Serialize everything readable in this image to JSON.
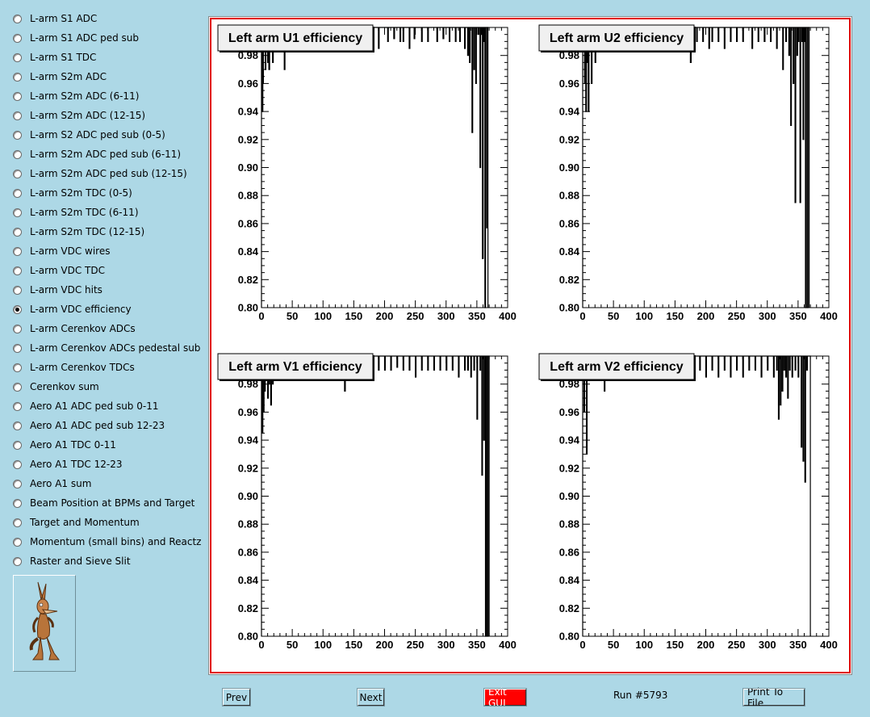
{
  "sidebar": {
    "items": [
      {
        "label": "L-arm S1 ADC",
        "selected": false
      },
      {
        "label": "L-arm S1 ADC ped sub",
        "selected": false
      },
      {
        "label": "L-arm S1 TDC",
        "selected": false
      },
      {
        "label": "L-arm S2m ADC",
        "selected": false
      },
      {
        "label": "L-arm S2m ADC (6-11)",
        "selected": false
      },
      {
        "label": "L-arm S2m ADC (12-15)",
        "selected": false
      },
      {
        "label": "L-arm S2 ADC ped sub (0-5)",
        "selected": false
      },
      {
        "label": "L-arm S2m ADC ped sub (6-11)",
        "selected": false
      },
      {
        "label": "L-arm S2m ADC ped sub (12-15)",
        "selected": false
      },
      {
        "label": "L-arm S2m TDC (0-5)",
        "selected": false
      },
      {
        "label": "L-arm S2m TDC (6-11)",
        "selected": false
      },
      {
        "label": "L-arm S2m TDC (12-15)",
        "selected": false
      },
      {
        "label": "L-arm VDC wires",
        "selected": false
      },
      {
        "label": "L-arm VDC TDC",
        "selected": false
      },
      {
        "label": "L-arm VDC hits",
        "selected": false
      },
      {
        "label": "L-arm VDC efficiency",
        "selected": true
      },
      {
        "label": "L-arm Cerenkov ADCs",
        "selected": false
      },
      {
        "label": "L-arm Cerenkov ADCs pedestal sub",
        "selected": false
      },
      {
        "label": "L-arm Cerenkov TDCs",
        "selected": false
      },
      {
        "label": "Cerenkov sum",
        "selected": false
      },
      {
        "label": "Aero A1 ADC ped sub 0-11",
        "selected": false
      },
      {
        "label": "Aero A1 ADC ped sub 12-23",
        "selected": false
      },
      {
        "label": "Aero A1 TDC 0-11",
        "selected": false
      },
      {
        "label": "Aero A1 TDC 12-23",
        "selected": false
      },
      {
        "label": "Aero A1 sum",
        "selected": false
      },
      {
        "label": "Beam Position at BPMs and Target",
        "selected": false
      },
      {
        "label": "Target and Momentum",
        "selected": false
      },
      {
        "label": "Momentum (small bins) and Reactz",
        "selected": false
      },
      {
        "label": "Raster and Sieve Slit",
        "selected": false
      }
    ]
  },
  "buttons": {
    "prev": "Prev",
    "next": "Next",
    "exit": "Exit GUI",
    "print": "Print To File"
  },
  "run_label": "Run #5793",
  "colors": {
    "background": "#add8e6",
    "canvas_border": "#e00000",
    "exit_button": "#ff0000",
    "plot_line": "#000000"
  },
  "chart_data": [
    {
      "type": "bar",
      "title": "Left arm U1 efficiency",
      "xlim": [
        0,
        400
      ],
      "ylim": [
        0.8,
        1.0
      ],
      "xticks": [
        "0",
        "50",
        "100",
        "150",
        "200",
        "250",
        "300",
        "350",
        "400"
      ],
      "yticks": [
        "0.80",
        "0.82",
        "0.84",
        "0.86",
        "0.88",
        "0.90",
        "0.92",
        "0.94",
        "0.96",
        "0.98"
      ],
      "fill_to": 368,
      "dips": [
        [
          1,
          0.94
        ],
        [
          2,
          0.96
        ],
        [
          4,
          0.985
        ],
        [
          6,
          0.97
        ],
        [
          8,
          0.99
        ],
        [
          10,
          0.975
        ],
        [
          12,
          0.97
        ],
        [
          15,
          0.985
        ],
        [
          18,
          0.975
        ],
        [
          20,
          0.99
        ],
        [
          25,
          0.985
        ],
        [
          30,
          0.99
        ],
        [
          37,
          0.97
        ],
        [
          45,
          0.99
        ],
        [
          55,
          0.992
        ],
        [
          65,
          0.99
        ],
        [
          80,
          0.99
        ],
        [
          95,
          0.992
        ],
        [
          110,
          0.99
        ],
        [
          125,
          0.99
        ],
        [
          140,
          0.985
        ],
        [
          155,
          0.992
        ],
        [
          165,
          0.985
        ],
        [
          180,
          0.99
        ],
        [
          190,
          0.985
        ],
        [
          205,
          0.99
        ],
        [
          215,
          0.992
        ],
        [
          225,
          0.99
        ],
        [
          230,
          0.99
        ],
        [
          240,
          0.985
        ],
        [
          248,
          0.992
        ],
        [
          260,
          0.99
        ],
        [
          270,
          0.99
        ],
        [
          285,
          0.99
        ],
        [
          295,
          0.992
        ],
        [
          305,
          0.99
        ],
        [
          315,
          0.99
        ],
        [
          322,
          0.99
        ],
        [
          330,
          0.985
        ],
        [
          335,
          0.98
        ],
        [
          338,
          0.975
        ],
        [
          342,
          0.925
        ],
        [
          345,
          0.97
        ],
        [
          348,
          0.96
        ],
        [
          352,
          0.995
        ],
        [
          355,
          0.9
        ],
        [
          357,
          0.995
        ],
        [
          359,
          0.835
        ],
        [
          361,
          0.99
        ],
        [
          363,
          0.8
        ],
        [
          366,
          0.857
        ]
      ]
    },
    {
      "type": "bar",
      "title": "Left arm U2 efficiency",
      "xlim": [
        0,
        400
      ],
      "ylim": [
        0.8,
        1.0
      ],
      "xticks": [
        "0",
        "50",
        "100",
        "150",
        "200",
        "250",
        "300",
        "350",
        "400"
      ],
      "yticks": [
        "0.80",
        "0.82",
        "0.84",
        "0.86",
        "0.88",
        "0.90",
        "0.92",
        "0.94",
        "0.96",
        "0.98"
      ],
      "fill_to": 368,
      "dips": [
        [
          1,
          0.99
        ],
        [
          3,
          0.96
        ],
        [
          5,
          0.94
        ],
        [
          7,
          0.975
        ],
        [
          9,
          0.94
        ],
        [
          11,
          0.985
        ],
        [
          14,
          0.96
        ],
        [
          17,
          0.99
        ],
        [
          20,
          0.975
        ],
        [
          25,
          0.99
        ],
        [
          35,
          0.985
        ],
        [
          48,
          0.99
        ],
        [
          60,
          0.992
        ],
        [
          75,
          0.985
        ],
        [
          90,
          0.99
        ],
        [
          105,
          0.985
        ],
        [
          120,
          0.99
        ],
        [
          135,
          0.992
        ],
        [
          150,
          0.985
        ],
        [
          160,
          0.992
        ],
        [
          175,
          0.975
        ],
        [
          185,
          0.99
        ],
        [
          195,
          0.99
        ],
        [
          205,
          0.985
        ],
        [
          210,
          0.99
        ],
        [
          220,
          0.99
        ],
        [
          230,
          0.985
        ],
        [
          240,
          0.99
        ],
        [
          250,
          0.99
        ],
        [
          260,
          0.99
        ],
        [
          275,
          0.985
        ],
        [
          285,
          0.99
        ],
        [
          295,
          0.99
        ],
        [
          305,
          0.99
        ],
        [
          315,
          0.985
        ],
        [
          325,
          0.97
        ],
        [
          330,
          0.99
        ],
        [
          335,
          0.98
        ],
        [
          338,
          0.93
        ],
        [
          342,
          0.96
        ],
        [
          345,
          0.875
        ],
        [
          348,
          0.98
        ],
        [
          350,
          0.99
        ],
        [
          353,
          0.875
        ],
        [
          356,
          0.99
        ],
        [
          358,
          0.92
        ],
        [
          360,
          0.99
        ],
        [
          362,
          0.8
        ],
        [
          365,
          0.8
        ]
      ]
    },
    {
      "type": "bar",
      "title": "Left arm V1 efficiency",
      "xlim": [
        0,
        400
      ],
      "ylim": [
        0.8,
        1.0
      ],
      "xticks": [
        "0",
        "50",
        "100",
        "150",
        "200",
        "250",
        "300",
        "350",
        "400"
      ],
      "yticks": [
        "0.80",
        "0.82",
        "0.84",
        "0.86",
        "0.88",
        "0.90",
        "0.92",
        "0.94",
        "0.96",
        "0.98"
      ],
      "fill_to": 370,
      "dips": [
        [
          1,
          0.945
        ],
        [
          3,
          0.96
        ],
        [
          5,
          0.975
        ],
        [
          8,
          0.985
        ],
        [
          10,
          0.97
        ],
        [
          12,
          0.98
        ],
        [
          15,
          0.965
        ],
        [
          18,
          0.98
        ],
        [
          22,
          0.99
        ],
        [
          28,
          0.99
        ],
        [
          35,
          0.99
        ],
        [
          45,
          0.992
        ],
        [
          55,
          0.99
        ],
        [
          70,
          0.99
        ],
        [
          85,
          0.99
        ],
        [
          100,
          0.99
        ],
        [
          115,
          0.992
        ],
        [
          128,
          0.985
        ],
        [
          135,
          0.975
        ],
        [
          145,
          0.99
        ],
        [
          155,
          0.99
        ],
        [
          170,
          0.992
        ],
        [
          180,
          0.99
        ],
        [
          190,
          0.99
        ],
        [
          200,
          0.99
        ],
        [
          210,
          0.99
        ],
        [
          220,
          0.992
        ],
        [
          230,
          0.99
        ],
        [
          240,
          0.99
        ],
        [
          250,
          0.985
        ],
        [
          260,
          0.99
        ],
        [
          270,
          0.99
        ],
        [
          280,
          0.99
        ],
        [
          290,
          0.99
        ],
        [
          300,
          0.99
        ],
        [
          310,
          0.99
        ],
        [
          320,
          0.985
        ],
        [
          330,
          0.99
        ],
        [
          335,
          0.99
        ],
        [
          340,
          0.985
        ],
        [
          345,
          0.99
        ],
        [
          350,
          0.955
        ],
        [
          355,
          0.99
        ],
        [
          358,
          0.915
        ],
        [
          361,
          0.94
        ],
        [
          364,
          0.8
        ],
        [
          367,
          0.8
        ]
      ]
    },
    {
      "type": "bar",
      "title": "Left arm V2 efficiency",
      "xlim": [
        0,
        400
      ],
      "ylim": [
        0.8,
        1.0
      ],
      "xticks": [
        "0",
        "50",
        "100",
        "150",
        "200",
        "250",
        "300",
        "350",
        "400"
      ],
      "yticks": [
        "0.80",
        "0.82",
        "0.84",
        "0.86",
        "0.88",
        "0.90",
        "0.92",
        "0.94",
        "0.96",
        "0.98"
      ],
      "fill_to": 370,
      "dips": [
        [
          2,
          0.96
        ],
        [
          4,
          0.99
        ],
        [
          6,
          0.93
        ],
        [
          8,
          0.985
        ],
        [
          12,
          0.99
        ],
        [
          18,
          0.985
        ],
        [
          25,
          0.99
        ],
        [
          35,
          0.975
        ],
        [
          45,
          0.99
        ],
        [
          55,
          0.99
        ],
        [
          70,
          0.99
        ],
        [
          85,
          0.992
        ],
        [
          100,
          0.99
        ],
        [
          115,
          0.99
        ],
        [
          130,
          0.99
        ],
        [
          145,
          0.99
        ],
        [
          160,
          0.992
        ],
        [
          175,
          0.99
        ],
        [
          190,
          0.99
        ],
        [
          200,
          0.985
        ],
        [
          210,
          0.99
        ],
        [
          220,
          0.985
        ],
        [
          230,
          0.99
        ],
        [
          240,
          0.985
        ],
        [
          250,
          0.99
        ],
        [
          260,
          0.985
        ],
        [
          270,
          0.99
        ],
        [
          280,
          0.99
        ],
        [
          290,
          0.985
        ],
        [
          300,
          0.99
        ],
        [
          310,
          0.985
        ],
        [
          315,
          0.99
        ],
        [
          318,
          0.955
        ],
        [
          321,
          0.965
        ],
        [
          324,
          0.975
        ],
        [
          327,
          0.99
        ],
        [
          330,
          0.985
        ],
        [
          333,
          0.97
        ],
        [
          336,
          0.99
        ],
        [
          340,
          0.985
        ],
        [
          345,
          0.99
        ],
        [
          350,
          0.985
        ],
        [
          355,
          0.935
        ],
        [
          358,
          0.925
        ],
        [
          361,
          0.91
        ],
        [
          364,
          0.99
        ]
      ]
    }
  ]
}
